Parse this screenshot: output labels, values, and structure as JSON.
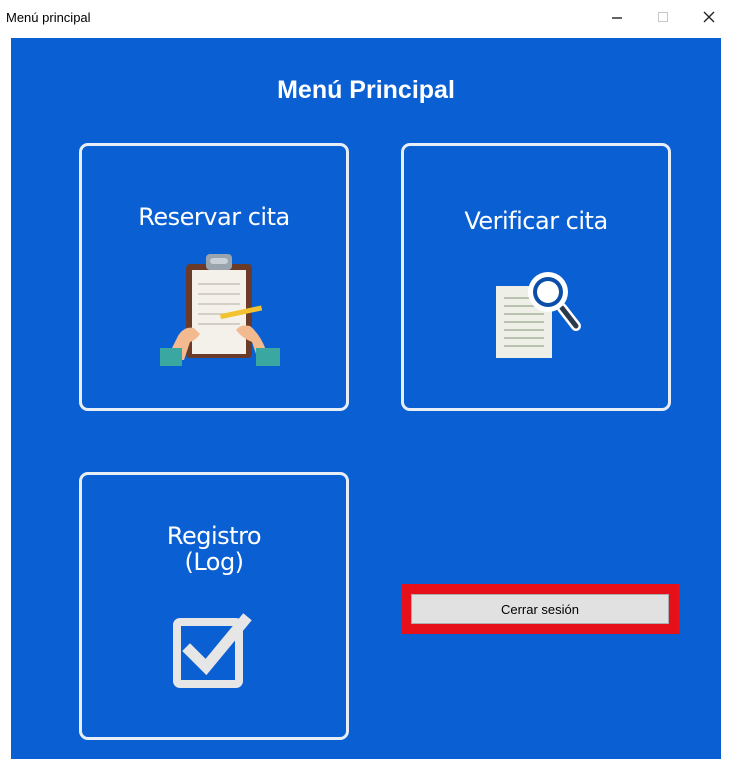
{
  "titlebar": {
    "title": "Menú principal",
    "minimize_icon": "minimize-icon",
    "maximize_icon": "maximize-icon",
    "close_icon": "close-icon"
  },
  "main": {
    "heading": "Menú Principal",
    "tiles": [
      {
        "label": "Reservar cita",
        "icon": "clipboard-icon"
      },
      {
        "label": "Verificar cita",
        "icon": "document-search-icon"
      },
      {
        "label": "Registro\n(Log)",
        "icon": "checkbox-icon"
      }
    ],
    "logout_label": "Cerrar sesión"
  },
  "colors": {
    "background": "#0a60d2",
    "tile_border": "#e8eef8",
    "highlight": "#e5101a",
    "button_face": "#e1e1e1"
  }
}
